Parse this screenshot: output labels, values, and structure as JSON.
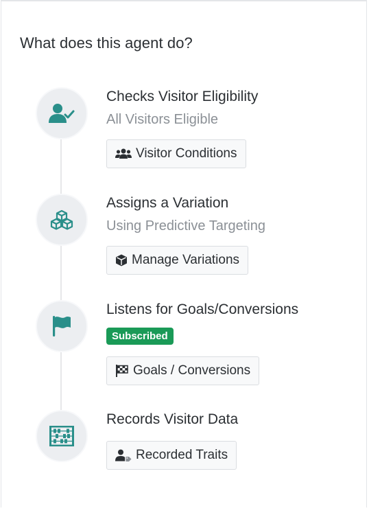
{
  "header": {
    "title": "What does this agent do?"
  },
  "colors": {
    "icon_teal": "#2a8f8a",
    "badge_green": "#1a9a57",
    "muted_text": "#8b9096"
  },
  "steps": [
    {
      "icon": "user-check-icon",
      "title": "Checks Visitor Eligibility",
      "subtitle": "All Visitors Eligible",
      "button": {
        "icon": "users-icon",
        "label": "Visitor Conditions"
      }
    },
    {
      "icon": "cubes-icon",
      "title": "Assigns a Variation",
      "subtitle": "Using Predictive Targeting",
      "button": {
        "icon": "cube-icon",
        "label": "Manage Variations"
      }
    },
    {
      "icon": "flag-icon",
      "title": "Listens for Goals/Conversions",
      "badge": "Subscribed",
      "button": {
        "icon": "checkered-flag-icon",
        "label": "Goals / Conversions"
      }
    },
    {
      "icon": "abacus-icon",
      "title": "Records Visitor Data",
      "button": {
        "icon": "user-tag-icon",
        "label": "Recorded Traits"
      }
    }
  ]
}
